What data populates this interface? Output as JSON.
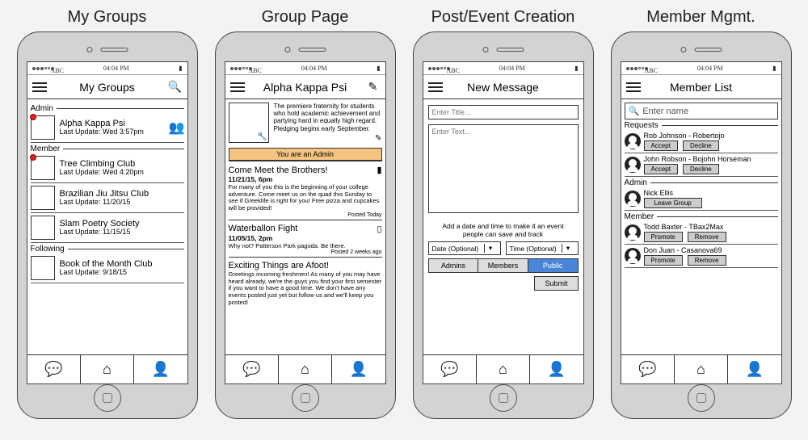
{
  "status": {
    "carrier": "ABC",
    "time": "04:04 PM"
  },
  "titles": {
    "col1": "My Groups",
    "col2": "Group Page",
    "col3": "Post/Event Creation",
    "col4": "Member Mgmt."
  },
  "screen1": {
    "header": "My Groups",
    "sections": {
      "admin": "Admin",
      "member": "Member",
      "following": "Following"
    },
    "admin_groups": [
      {
        "name": "Alpha Kappa Psi",
        "sub": "Last Update: Wed 3:57pm",
        "has_dot": true
      }
    ],
    "member_groups": [
      {
        "name": "Tree Climbing Club",
        "sub": "Last Update: Wed 4:20pm",
        "has_dot": true
      },
      {
        "name": "Brazilian Jiu Jitsu Club",
        "sub": "Last Update: 11/20/15",
        "has_dot": false
      },
      {
        "name": "Slam Poetry Society",
        "sub": "Last Update: 11/15/15",
        "has_dot": false
      }
    ],
    "following_groups": [
      {
        "name": "Book of the Month Club",
        "sub": "Last Update: 9/18/15",
        "has_dot": false
      }
    ]
  },
  "screen2": {
    "header": "Alpha Kappa Psi",
    "description": "The premiere fraternity for students who hold academic achievement and partying hard in equally high regard. Pledging begins early September.",
    "banner": "You are an Admin",
    "posts": [
      {
        "title": "Come Meet the Brothers!",
        "sub": "11/21/15, 6pm",
        "body": "For many of you this is the beginning of your college adventure. Come meet us on the quad this Sunday to see if Greeklife is right for you! Free pizza and cupcakes will be provided!",
        "foot": "Posted Today",
        "bookmarked": true
      },
      {
        "title": "Waterballon Fight",
        "sub": "11/05/15, 2pm",
        "body": "Why not? Patterson Park pagoda. Be there.",
        "foot": "Posted 2 weeks ago",
        "bookmarked": false
      },
      {
        "title": "Exciting Things are Afoot!",
        "sub": "",
        "body": "Greetings incoming freshmen! As many of you may have heard already, we're the guys you find your first semester if you want to have a good time. We don't have any events posted just yet but follow us and we'll keep you posted!",
        "foot": "",
        "bookmarked": null
      }
    ]
  },
  "screen3": {
    "header": "New Message",
    "title_ph": "Enter Title...",
    "text_ph": "Enter Text...",
    "helper": "Add a date and time to make it an event people can save and track",
    "date_ph": "Date (Optional)",
    "time_ph": "Time (Optional)",
    "segs": {
      "admins": "Admins",
      "members": "Members",
      "public": "Public"
    },
    "submit": "Submit"
  },
  "screen4": {
    "header": "Member List",
    "search_ph": "Enter name",
    "sections": {
      "requests": "Requests",
      "admin": "Admin",
      "member": "Member"
    },
    "buttons": {
      "accept": "Accept",
      "decline": "Decline",
      "leave": "Leave Group",
      "promote": "Promote",
      "remove": "Remove"
    },
    "requests": [
      {
        "name": "Rob Johnson - Robertojo"
      },
      {
        "name": "John Robson - Bojohn Horseman"
      }
    ],
    "admins": [
      {
        "name": "Nick Ellis"
      }
    ],
    "members": [
      {
        "name": "Todd Baxter - TBax2Max"
      },
      {
        "name": "Don Juan - Casanova69"
      }
    ]
  }
}
